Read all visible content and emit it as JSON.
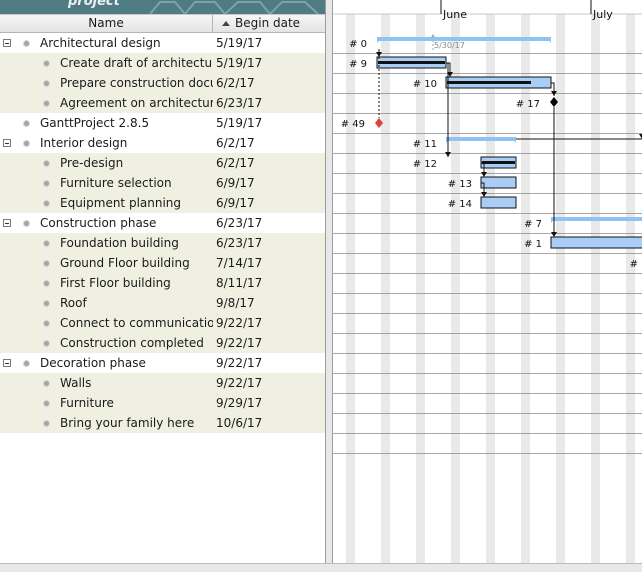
{
  "app": {
    "logo_text": "project"
  },
  "table": {
    "columns": {
      "name": "Name",
      "begin_date": "Begin date"
    },
    "rows": [
      {
        "name": "Architectural design",
        "date": "5/19/17",
        "level": 0,
        "group": true
      },
      {
        "name": "Create draft of architecture",
        "date": "5/19/17",
        "level": 1,
        "group": false
      },
      {
        "name": "Prepare construction docu...",
        "date": "6/2/17",
        "level": 1,
        "group": false
      },
      {
        "name": "Agreement on architectura...",
        "date": "6/23/17",
        "level": 1,
        "group": false
      },
      {
        "name": "GanttProject 2.8.5",
        "date": "5/19/17",
        "level": 0,
        "group": false
      },
      {
        "name": "Interior design",
        "date": "6/2/17",
        "level": 0,
        "group": true
      },
      {
        "name": "Pre-design",
        "date": "6/2/17",
        "level": 1,
        "group": false
      },
      {
        "name": "Furniture selection",
        "date": "6/9/17",
        "level": 1,
        "group": false
      },
      {
        "name": "Equipment planning",
        "date": "6/9/17",
        "level": 1,
        "group": false
      },
      {
        "name": "Construction phase",
        "date": "6/23/17",
        "level": 0,
        "group": true
      },
      {
        "name": "Foundation building",
        "date": "6/23/17",
        "level": 1,
        "group": false
      },
      {
        "name": "Ground Floor building",
        "date": "7/14/17",
        "level": 1,
        "group": false
      },
      {
        "name": "First Floor building",
        "date": "8/11/17",
        "level": 1,
        "group": false
      },
      {
        "name": "Roof",
        "date": "9/8/17",
        "level": 1,
        "group": false
      },
      {
        "name": "Connect to communications",
        "date": "9/22/17",
        "level": 1,
        "group": false
      },
      {
        "name": "Construction completed",
        "date": "9/22/17",
        "level": 1,
        "group": false
      },
      {
        "name": "Decoration phase",
        "date": "9/22/17",
        "level": 0,
        "group": true
      },
      {
        "name": "Walls",
        "date": "9/22/17",
        "level": 1,
        "group": false
      },
      {
        "name": "Furniture",
        "date": "9/29/17",
        "level": 1,
        "group": false
      },
      {
        "name": "Bring your family here",
        "date": "10/6/17",
        "level": 1,
        "group": false
      }
    ]
  },
  "chart": {
    "months": [
      "June",
      "July"
    ],
    "today_label": "5/30/17",
    "task_ids": [
      "# 0",
      "# 9",
      "# 10",
      "# 17",
      "# 49",
      "# 11",
      "# 12",
      "# 13",
      "# 14",
      "# 7",
      "# 1",
      "#"
    ],
    "colors": {
      "bar": "#a9cdf4",
      "summary": "#8fc3f3",
      "milestone": "#000000",
      "project_milestone": "#e2403c",
      "weekend": "#e9e9e9"
    }
  }
}
